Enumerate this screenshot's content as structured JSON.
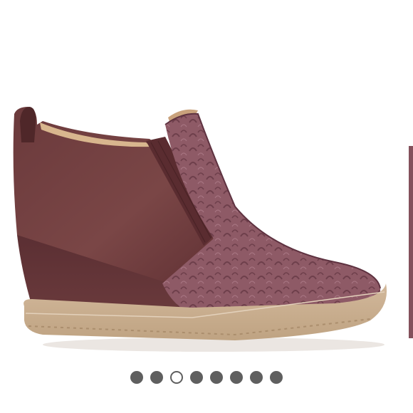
{
  "carousel": {
    "slide_count": 8,
    "active_index": 2,
    "image_subject": "brown-suede-wedge-bootie"
  },
  "colors": {
    "background": "#ffffff",
    "dot_inactive": "#5f5f5f",
    "dot_active_border": "#5f5f5f",
    "dot_active_fill": "#ffffff",
    "suede_dark": "#6b3a3c",
    "suede_mid": "#7d4a4b",
    "woven_panel": "#8e5a66",
    "sole": "#c9ae90"
  }
}
